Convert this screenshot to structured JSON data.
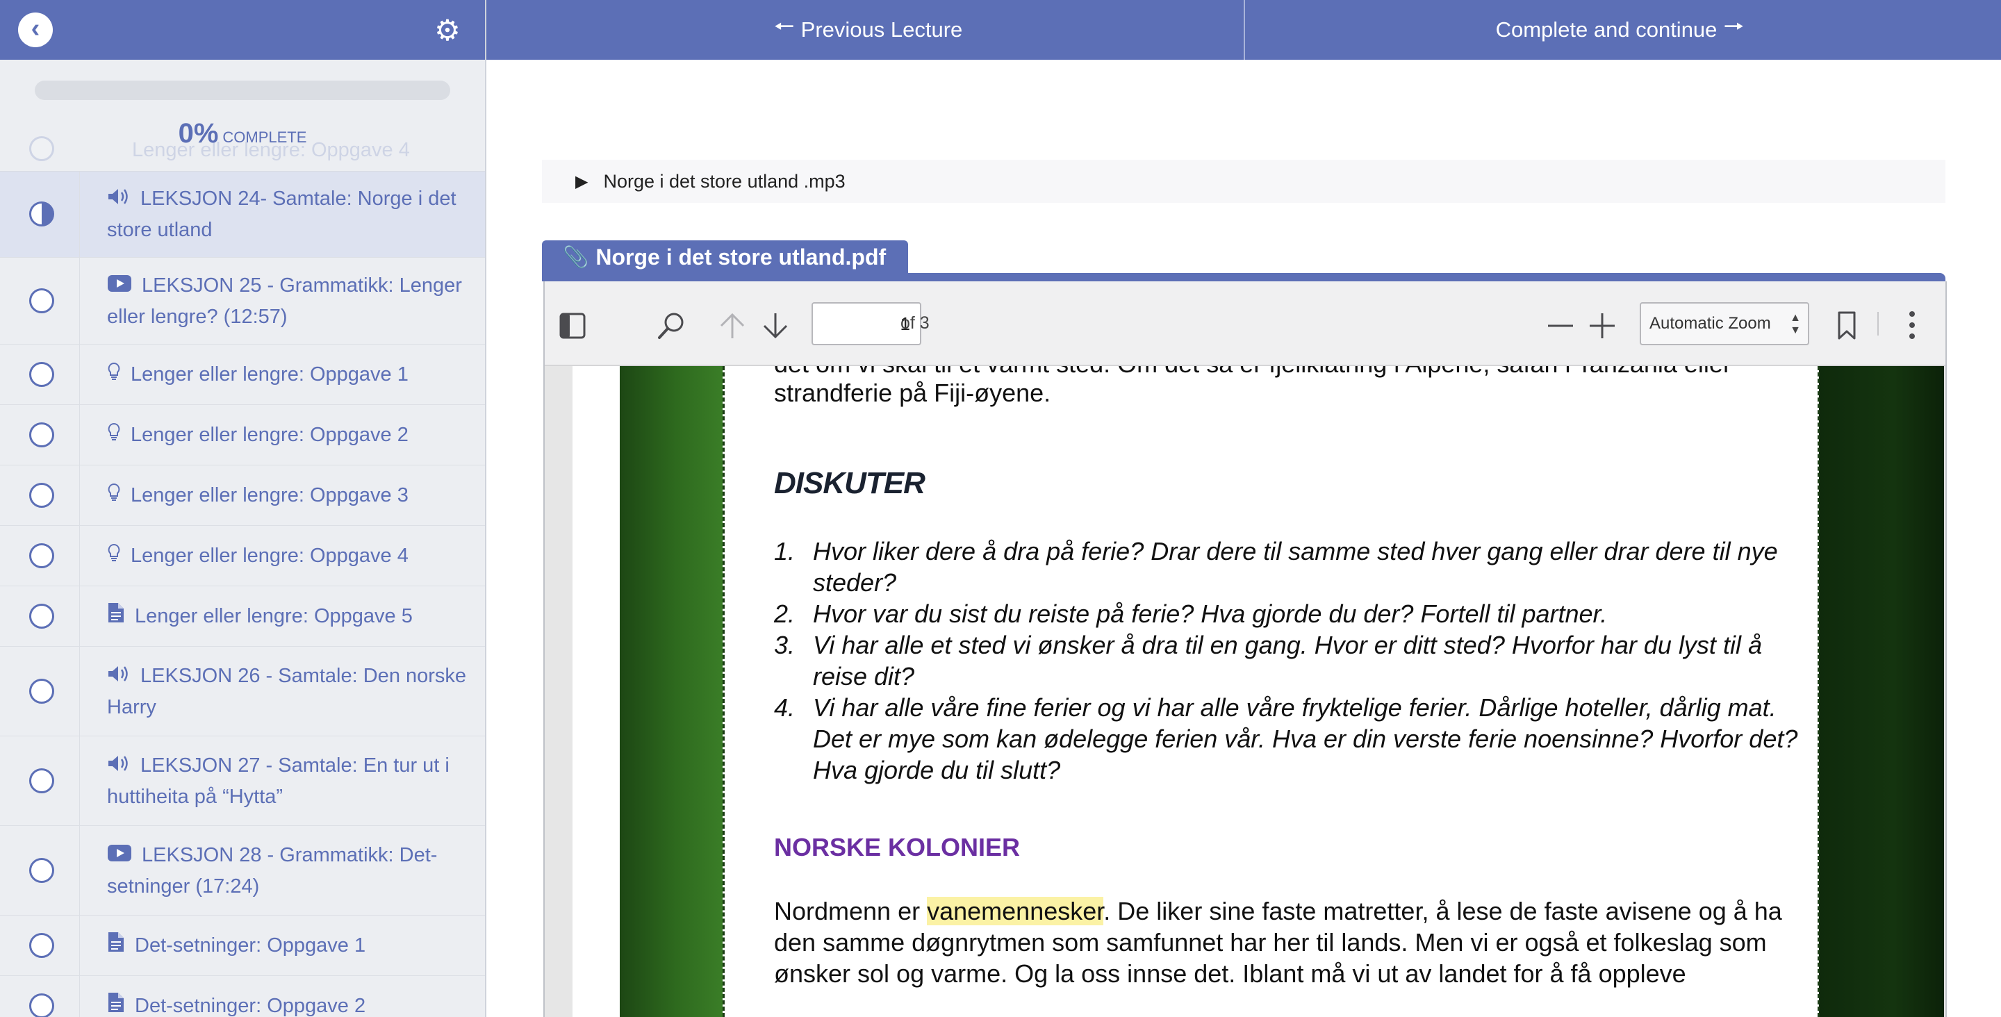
{
  "topbar": {
    "prev_label": "Previous Lecture",
    "next_label": "Complete and continue",
    "back_icon": "chevron-left-icon",
    "settings_icon": "gear-icon"
  },
  "progress": {
    "value": 0,
    "percent_text": "0%",
    "label": "COMPLETE"
  },
  "lectures": [
    {
      "label": "Lenger eller lengre: Oppgave 4",
      "type": "lightbulb-icon",
      "status": "empty",
      "ghost": true
    },
    {
      "label": "LEKSJON 24- Samtale: Norge i det store utland",
      "type": "audio-icon",
      "status": "half",
      "active": true
    },
    {
      "label": "LEKSJON 25 - Grammatikk: Lenger eller lengre? (12:57)",
      "type": "video-icon",
      "status": "empty"
    },
    {
      "label": "Lenger eller lengre: Oppgave 1",
      "type": "lightbulb-icon",
      "status": "empty"
    },
    {
      "label": "Lenger eller lengre: Oppgave 2",
      "type": "lightbulb-icon",
      "status": "empty"
    },
    {
      "label": "Lenger eller lengre: Oppgave 3",
      "type": "lightbulb-icon",
      "status": "empty"
    },
    {
      "label": "Lenger eller lengre: Oppgave 4",
      "type": "lightbulb-icon",
      "status": "empty"
    },
    {
      "label": "Lenger eller lengre: Oppgave 5",
      "type": "document-icon",
      "status": "empty"
    },
    {
      "label": "LEKSJON 26 - Samtale: Den norske Harry",
      "type": "audio-icon",
      "status": "empty"
    },
    {
      "label": "LEKSJON 27 - Samtale: En tur ut i huttiheita på “Hytta”",
      "type": "audio-icon",
      "status": "empty"
    },
    {
      "label": "LEKSJON 28 - Grammatikk: Det-setninger (17:24)",
      "type": "video-icon",
      "status": "empty"
    },
    {
      "label": "Det-setninger: Oppgave 1",
      "type": "document-icon",
      "status": "empty"
    },
    {
      "label": "Det-setninger: Oppgave 2",
      "type": "document-icon",
      "status": "empty"
    }
  ],
  "audio": {
    "filename": "Norge i det store utland .mp3",
    "play_icon": "play-icon"
  },
  "pdf": {
    "tab_label": "Norge i det store utland.pdf",
    "tab_icon": "paperclip-icon",
    "page_value": "1",
    "page_total": "of 3",
    "zoom": "Automatic Zoom"
  },
  "doc": {
    "partial_line": "det om vi skal til et varmt sted. Om det så er fjellklatring i Alpene, safari i Tanzania eller",
    "para_end": "strandferie på Fiji-øyene.",
    "heading_discuss": "DISKUTER",
    "questions": [
      {
        "num": "1.",
        "text": "Hvor liker dere å dra på ferie? Drar dere til samme sted hver gang eller drar dere til nye steder?"
      },
      {
        "num": "2.",
        "text": "Hvor var du sist du reiste på ferie? Hva gjorde du der? Fortell til partner."
      },
      {
        "num": "3.",
        "text": "Vi har alle et sted vi ønsker å dra til en gang. Hvor er ditt sted? Hvorfor har du lyst til å reise dit?"
      },
      {
        "num": "4.",
        "text": "Vi har alle våre fine ferier og vi har alle våre fryktelige ferier. Dårlige hoteller, dårlig mat. Det er mye som kan ødelegge ferien vår. Hva er din verste ferie noensinne? Hvorfor det? Hva gjorde du til slutt?"
      }
    ],
    "heading_colonies": "NORSKE KOLONIER",
    "body_before": "Nordmenn er ",
    "body_highlight": "vanemennesker",
    "body_after": ". De liker sine faste matretter, å lese de faste avisene og å ha den samme døgnrytmen som samfunnet har her til lands. Men vi er også et folkeslag som ønsker sol og varme. Og la oss innse det. Iblant må vi ut av landet for å få oppleve"
  },
  "colors": {
    "brand": "#5c6fb6",
    "sidebar_bg": "#eceef2",
    "active_item_bg": "#dde2f0",
    "heading_purple": "#6b2fa2",
    "highlight": "#fbf2a5"
  }
}
